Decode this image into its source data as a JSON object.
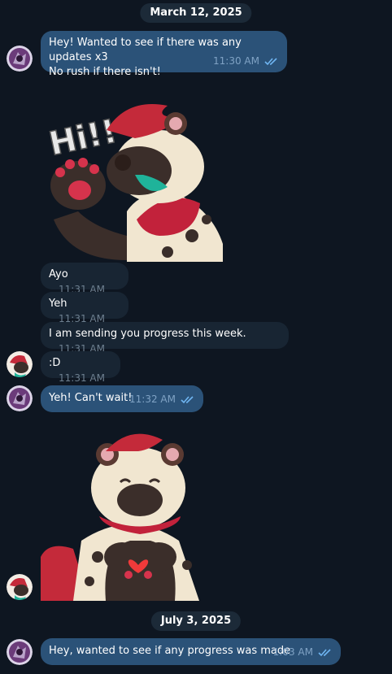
{
  "dates": [
    "March 12, 2025",
    "July 3, 2025"
  ],
  "messages": [
    {
      "lines": [
        "Hey! Wanted to see if there was any updates x3",
        "No rush if there isn't!"
      ],
      "time": "11:30 AM",
      "direction": "out"
    },
    {
      "text": "Ayo",
      "time": "11:31 AM",
      "direction": "in"
    },
    {
      "text": "Yeh",
      "time": "11:31 AM",
      "direction": "in"
    },
    {
      "text": "I am sending you progress this week.",
      "time": "11:31 AM",
      "direction": "in"
    },
    {
      "text": ":D",
      "time": "11:31 AM",
      "direction": "in"
    },
    {
      "text": "Yeh! Can't wait!",
      "time": "11:32 AM",
      "direction": "out"
    },
    {
      "text": "Hey, wanted to see if any progress was made",
      "time": "1:03 AM",
      "direction": "out"
    }
  ],
  "stickers": [
    {
      "caption": "Hi!!",
      "name": "hyena waving"
    },
    {
      "name": "hyena heart hands"
    }
  ],
  "colors": {
    "background": "#0e1621",
    "outgoing_bubble": "#2b5278",
    "incoming_bubble": "#182533",
    "read_ticks": "#6fb5f2"
  }
}
